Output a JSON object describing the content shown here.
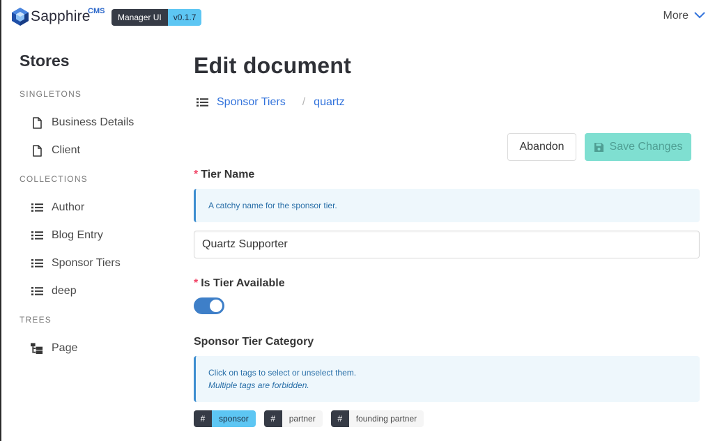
{
  "app": {
    "brand_name": "Sapphire",
    "brand_superscript": "CMS",
    "badge_left": "Manager UI",
    "badge_right": "v0.1.7",
    "more_label": "More"
  },
  "sidebar": {
    "title": "Stores",
    "sections": [
      {
        "heading": "SINGLETONS",
        "items": [
          {
            "label": "Business Details",
            "icon": "file-icon"
          },
          {
            "label": "Client",
            "icon": "file-icon"
          }
        ]
      },
      {
        "heading": "COLLECTIONS",
        "items": [
          {
            "label": "Author",
            "icon": "list-icon"
          },
          {
            "label": "Blog Entry",
            "icon": "list-icon"
          },
          {
            "label": "Sponsor Tiers",
            "icon": "list-icon"
          },
          {
            "label": "deep",
            "icon": "list-icon"
          }
        ]
      },
      {
        "heading": "TREES",
        "items": [
          {
            "label": "Page",
            "icon": "tree-icon"
          }
        ]
      }
    ]
  },
  "main": {
    "title": "Edit document",
    "breadcrumb": {
      "collection": "Sponsor Tiers",
      "document": "quartz",
      "separator": "/"
    },
    "buttons": {
      "abandon": "Abandon",
      "save": "Save Changes"
    },
    "fields": {
      "tier_name": {
        "label": "Tier Name",
        "required_mark": "*",
        "help": "A catchy name for the sponsor tier.",
        "value": "Quartz Supporter"
      },
      "is_available": {
        "label": "Is Tier Available",
        "required_mark": "*",
        "value": true
      },
      "category": {
        "label": "Sponsor Tier Category",
        "help_line1": "Click on tags to select or unselect them.",
        "help_line2": "Multiple tags are forbidden.",
        "tag_prefix": "#",
        "tags": [
          {
            "label": "sponsor",
            "selected": true
          },
          {
            "label": "partner",
            "selected": false
          },
          {
            "label": "founding partner",
            "selected": false
          }
        ]
      }
    }
  },
  "colors": {
    "link": "#3273dc",
    "save_button": "#7fdfd1",
    "toggle_on": "#3e7fc8",
    "tag_selected": "#5dc6f3",
    "required": "#f14668"
  }
}
